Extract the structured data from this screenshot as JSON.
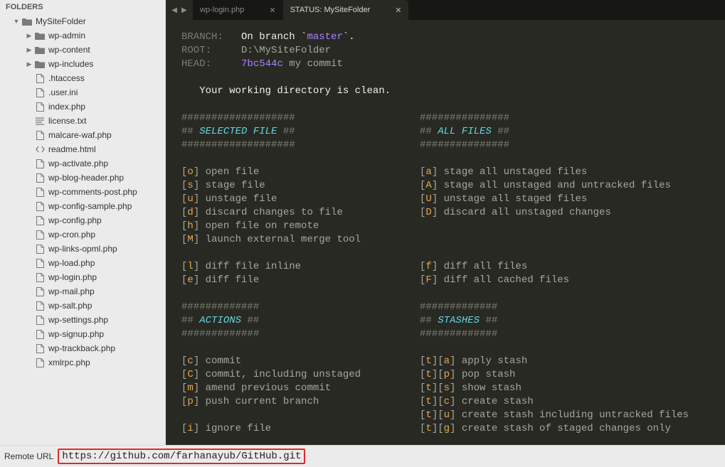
{
  "sidebar": {
    "header": "FOLDERS",
    "root": {
      "label": "MySiteFolder",
      "expanded": true
    },
    "folders": [
      {
        "label": "wp-admin"
      },
      {
        "label": "wp-content"
      },
      {
        "label": "wp-includes"
      }
    ],
    "files": [
      {
        "label": ".htaccess",
        "icon": "file"
      },
      {
        "label": ".user.ini",
        "icon": "file"
      },
      {
        "label": "index.php",
        "icon": "file"
      },
      {
        "label": "license.txt",
        "icon": "text"
      },
      {
        "label": "malcare-waf.php",
        "icon": "file"
      },
      {
        "label": "readme.html",
        "icon": "code"
      },
      {
        "label": "wp-activate.php",
        "icon": "file"
      },
      {
        "label": "wp-blog-header.php",
        "icon": "file"
      },
      {
        "label": "wp-comments-post.php",
        "icon": "file"
      },
      {
        "label": "wp-config-sample.php",
        "icon": "file"
      },
      {
        "label": "wp-config.php",
        "icon": "file"
      },
      {
        "label": "wp-cron.php",
        "icon": "file"
      },
      {
        "label": "wp-links-opml.php",
        "icon": "file"
      },
      {
        "label": "wp-load.php",
        "icon": "file"
      },
      {
        "label": "wp-login.php",
        "icon": "file"
      },
      {
        "label": "wp-mail.php",
        "icon": "file"
      },
      {
        "label": "wp-salt.php",
        "icon": "file"
      },
      {
        "label": "wp-settings.php",
        "icon": "file"
      },
      {
        "label": "wp-signup.php",
        "icon": "file"
      },
      {
        "label": "wp-trackback.php",
        "icon": "file"
      },
      {
        "label": "xmlrpc.php",
        "icon": "file"
      }
    ]
  },
  "tabs": [
    {
      "label": "wp-login.php",
      "active": false
    },
    {
      "label": "STATUS: MySiteFolder",
      "active": true
    }
  ],
  "status": {
    "branch_label": "BRANCH:",
    "branch_prefix": "On branch `",
    "branch_name": "master",
    "branch_suffix": "`.",
    "root_label": "ROOT:",
    "root_value": "D:\\MySiteFolder",
    "head_label": "HEAD:",
    "head_hash": "7bc544c",
    "head_msg": "my commit",
    "clean_msg": "Your working directory is clean.",
    "hr_small": "#############",
    "hr_med": "###############",
    "hr_long": "###################",
    "sel_file": "SELECTED FILE",
    "all_files": "ALL FILES",
    "actions": "ACTIONS",
    "stashes": "STASHES",
    "left_group1": [
      {
        "k": "o",
        "t": "open file"
      },
      {
        "k": "s",
        "t": "stage file"
      },
      {
        "k": "u",
        "t": "unstage file"
      },
      {
        "k": "d",
        "t": "discard changes to file"
      },
      {
        "k": "h",
        "t": "open file on remote"
      },
      {
        "k": "M",
        "t": "launch external merge tool"
      }
    ],
    "right_group1": [
      {
        "k": "a",
        "t": "stage all unstaged files"
      },
      {
        "k": "A",
        "t": "stage all unstaged and untracked files"
      },
      {
        "k": "U",
        "t": "unstage all staged files"
      },
      {
        "k": "D",
        "t": "discard all unstaged changes"
      }
    ],
    "left_group2": [
      {
        "k": "l",
        "t": "diff file inline"
      },
      {
        "k": "e",
        "t": "diff file"
      }
    ],
    "right_group2": [
      {
        "k": "f",
        "t": "diff all files"
      },
      {
        "k": "F",
        "t": "diff all cached files"
      }
    ],
    "left_group3": [
      {
        "k": "c",
        "t": "commit"
      },
      {
        "k": "C",
        "t": "commit, including unstaged"
      },
      {
        "k": "m",
        "t": "amend previous commit"
      },
      {
        "k": "p",
        "t": "push current branch"
      }
    ],
    "right_group3": [
      {
        "k1": "t",
        "k2": "a",
        "t": "apply stash"
      },
      {
        "k1": "t",
        "k2": "p",
        "t": "pop stash"
      },
      {
        "k1": "t",
        "k2": "s",
        "t": "show stash"
      },
      {
        "k1": "t",
        "k2": "c",
        "t": "create stash"
      },
      {
        "k1": "t",
        "k2": "u",
        "t": "create stash including untracked files"
      },
      {
        "k1": "t",
        "k2": "g",
        "t": "create stash of staged changes only"
      }
    ],
    "left_group4": [
      {
        "k": "i",
        "t": "ignore file"
      }
    ]
  },
  "statusbar": {
    "label": "Remote URL",
    "url": "https://github.com/farhanayub/GitHub.git"
  }
}
